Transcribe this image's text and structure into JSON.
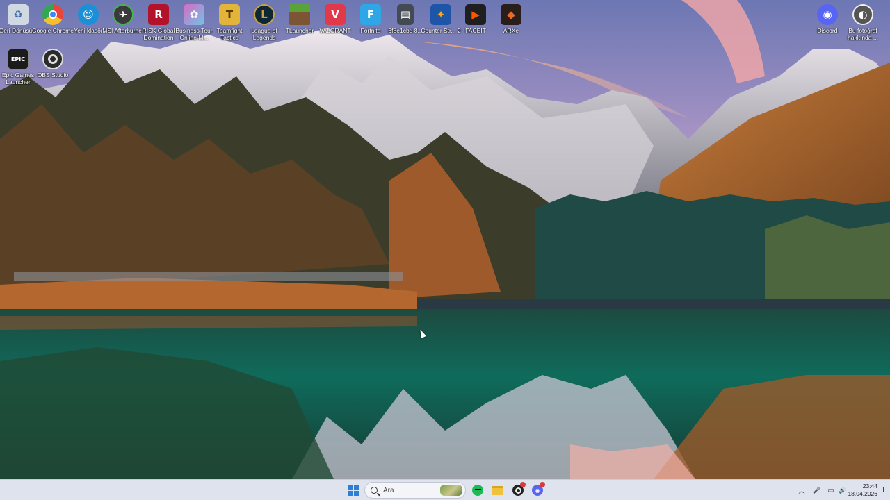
{
  "desktop": {
    "icons": [
      {
        "label": "Geri Dönüşü...",
        "icon": "recycle-bin-icon",
        "color": "#cfd8e3"
      },
      {
        "label": "Google Chrome",
        "icon": "chrome-icon",
        "color": "#e8453c"
      },
      {
        "label": "Yeni klasör",
        "icon": "accessibility-icon",
        "color": "#1c8fd9"
      },
      {
        "label": "MSI Afterburner",
        "icon": "msi-afterburner-icon",
        "color": "#3a3a3a"
      },
      {
        "label": "RISK Global Domination",
        "icon": "risk-icon",
        "color": "#b3122b"
      },
      {
        "label": "Business Tour Online M...",
        "icon": "business-tour-icon",
        "color": "#d76bc2"
      },
      {
        "label": "Teamfight Tactics",
        "icon": "tft-icon",
        "color": "#e2b53a"
      },
      {
        "label": "League of Legends",
        "icon": "lol-icon",
        "color": "#0d2733"
      },
      {
        "label": "TLauncher",
        "icon": "minecraft-icon",
        "color": "#4f8a2b"
      },
      {
        "label": "VALORANT",
        "icon": "valorant-icon",
        "color": "#e0394a"
      },
      {
        "label": "Fortnite",
        "icon": "fortnite-icon",
        "color": "#2fa7e6"
      },
      {
        "label": "6f8e1cbd 8...",
        "icon": "file-icon",
        "color": "#444a52"
      },
      {
        "label": "Counter Str... 2",
        "icon": "cs2-icon",
        "color": "#1d55a8"
      },
      {
        "label": "FACEIT",
        "icon": "faceit-icon",
        "color": "#1f1f1f"
      },
      {
        "label": "ARXe",
        "icon": "arxe-icon",
        "color": "#2a1e1a"
      },
      {
        "label": "Epic Games Launcher",
        "icon": "epic-games-icon",
        "color": "#1b1b1b"
      },
      {
        "label": "OBS Studio",
        "icon": "obs-icon",
        "color": "#2b2b2b"
      },
      {
        "label": "Discord",
        "icon": "discord-icon",
        "color": "#5865f2"
      },
      {
        "label": "Bu fotoğraf hakkında ...",
        "icon": "spotlight-info-icon",
        "color": "#555555"
      }
    ],
    "glyphs": {
      "chrome": "",
      "risk": "R",
      "tft": "T",
      "lol": "L",
      "valorant": "V",
      "fortnite": "F",
      "epic": "EPIC",
      "discord": "",
      "faceit": "▶",
      "arxe": "◆",
      "file": "▤"
    }
  },
  "taskbar": {
    "search_placeholder": "Ara",
    "time": "23:44",
    "date": "18.04.2026",
    "tray_overflow_glyph": "︿",
    "mic_glyph": "🎤",
    "network_glyph": "▭",
    "volume_glyph": "🔊",
    "colors": {
      "start": "#2b7fd6",
      "spotify": "#1db954",
      "files": "#f2c13c",
      "obs": "#222222",
      "discord": "#5865f2",
      "badge": "#d93b3b"
    }
  }
}
